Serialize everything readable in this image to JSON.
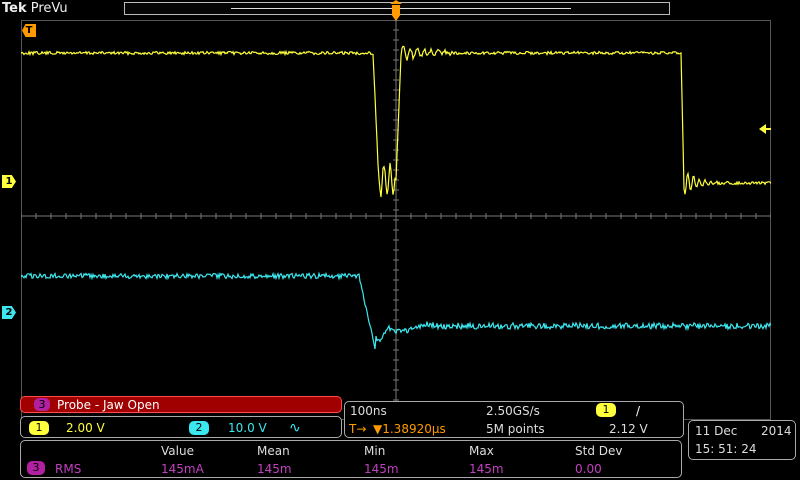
{
  "header": {
    "brand_bold": "Tek",
    "mode": "PreVu"
  },
  "markers": {
    "trigger": "T",
    "ch1": "1",
    "ch2": "2"
  },
  "waveform_label": {
    "channel": "3",
    "text": "Probe - Jaw Open"
  },
  "vertical": {
    "ch1": {
      "num": "1",
      "scale": "2.00 V",
      "color": "#ffff3c"
    },
    "ch2": {
      "num": "2",
      "scale": "10.0 V",
      "coupling_symbol": "∿",
      "color": "#3ce8f0"
    }
  },
  "horizontal": {
    "time_div": "100ns",
    "sample_rate": "2.50GS/s",
    "trigger_channel": "1",
    "trigger_slope": "/",
    "trigger_icon": "T→",
    "trigger_delay": "▼1.38920µs",
    "record_length": "5M points",
    "trigger_level": "2.12 V"
  },
  "datetime": {
    "date": "11 Dec",
    "year": "2014",
    "time": "15: 51: 24"
  },
  "measurements": {
    "headers": [
      "Value",
      "Mean",
      "Min",
      "Max",
      "Std Dev"
    ],
    "row": {
      "channel": "3",
      "name": "RMS",
      "values": [
        "145mA",
        "145m",
        "145m",
        "145m",
        "0.00"
      ]
    },
    "color": "#c040c0"
  }
}
